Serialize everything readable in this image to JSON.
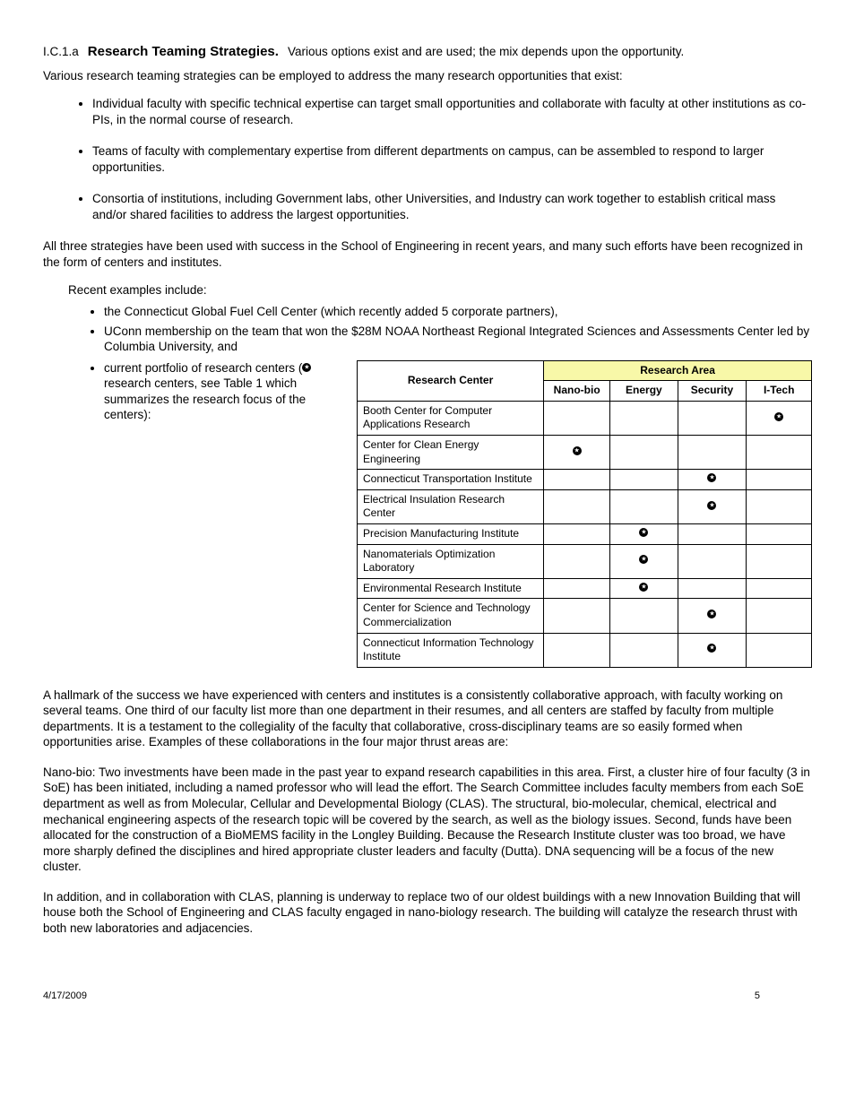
{
  "section": {
    "id": "I.C.1.a",
    "title": "Research Teaming Strategies.",
    "subtitle": "Various options exist and are used; the mix depends upon the opportunity."
  },
  "intro": "Various research teaming strategies can be employed to address the many research opportunities that exist:",
  "bullets_top": [
    "Individual faculty with specific technical expertise can target small opportunities and collaborate with faculty at other institutions as co-PIs, in the normal course of research.",
    "Teams of faculty with complementary expertise from different departments on campus, can be assembled to respond to larger opportunities.",
    "Consortia of institutions, including Government labs, other Universities, and Industry can work together to establish critical mass and/or shared facilities to address the largest opportunities."
  ],
  "bridge": "All three strategies have been used with success in the School of Engineering in recent years, and many such efforts have been recognized in the form of centers and institutes.",
  "inner_intro": "Recent examples include:",
  "inner_bullets": [
    "the Connecticut Global Fuel Cell Center (which recently added 5 corporate partners),",
    "UConn membership on the team that won the $28M NOAA Northeast Regional Integrated Sciences and Assessments Center led by Columbia University, and",
    "current portfolio of research centers ("
  ],
  "inner_bullets_tail": " research centers, see Table 1 which summarizes the research focus of the centers):",
  "table": {
    "title_header": "Research Center",
    "area_header": "Research Area",
    "areas": [
      "Nano-bio",
      "Energy",
      "Security",
      "I-Tech"
    ],
    "rows": [
      {
        "label": "Booth Center for Computer Applications Research",
        "col": 3
      },
      {
        "label": "Center for Clean Energy Engineering",
        "col": 0
      },
      {
        "label": "Connecticut Transportation Institute",
        "col": 2
      },
      {
        "label": "Electrical Insulation Research Center",
        "col": 2
      },
      {
        "label": "Precision Manufacturing Institute",
        "col": 1
      },
      {
        "label": "Nanomaterials Optimization Laboratory",
        "col": 1
      },
      {
        "label": "Environmental Research Institute",
        "col": 1
      },
      {
        "label": "Center for Science and Technology Commercialization",
        "col": 2
      },
      {
        "label": "Connecticut Information Technology Institute",
        "col": 2
      }
    ]
  },
  "followups": [
    "A hallmark of the success we have experienced with centers and institutes is a consistently collaborative approach, with faculty working on several teams. One third of our faculty list more than one department in their resumes, and all centers are staffed by faculty from multiple departments. It is a testament to the collegiality of the faculty that collaborative, cross-disciplinary teams are so easily formed when opportunities arise. Examples of these collaborations in the four major thrust areas are:",
    "Nano-bio: Two investments have been made in the past year to expand research capabilities in this area. First, a cluster hire of four faculty (3 in SoE) has been initiated, including a named professor who will lead the effort. The Search Committee includes faculty members from each SoE department as well as from Molecular, Cellular and Developmental Biology (CLAS). The structural, bio-molecular, chemical, electrical and mechanical engineering aspects of the research topic will be covered by the search, as well as the biology issues. Second, funds have been allocated for the construction of a BioMEMS facility in the Longley Building. Because the Research Institute cluster was too broad, we have more sharply defined the disciplines and hired appropriate cluster leaders and faculty (Dutta). DNA sequencing will be a focus of the new cluster.",
    "In addition, and in collaboration with CLAS, planning is underway to replace two of our oldest buildings with a new Innovation Building that will house both the School of Engineering and CLAS faculty engaged in nano-biology research. The building will catalyze the research thrust with both new laboratories and adjacencies."
  ],
  "footer": {
    "left": "4/17/2009",
    "right": "5"
  }
}
